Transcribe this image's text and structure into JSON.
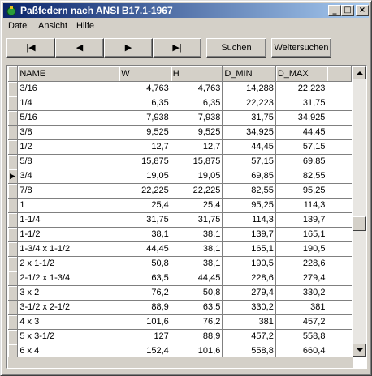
{
  "window": {
    "title": "Paßfedern nach ANSI B17.1-1967"
  },
  "titlebar_buttons": {
    "minimize": "_",
    "maximize": "□",
    "close": "×"
  },
  "menu": [
    {
      "label": "Datei"
    },
    {
      "label": "Ansicht"
    },
    {
      "label": "Hilfe"
    }
  ],
  "toolbar": {
    "first": "|◀",
    "prev": "◀",
    "next": "▶",
    "last": "▶|",
    "search": "Suchen",
    "search_next": "Weitersuchen"
  },
  "table": {
    "columns": [
      "NAME",
      "W",
      "H",
      "D_MIN",
      "D_MAX"
    ],
    "current_row_indicator": "▶",
    "current_row": 6,
    "rows": [
      [
        "3/16",
        "4,763",
        "4,763",
        "14,288",
        "22,223"
      ],
      [
        "1/4",
        "6,35",
        "6,35",
        "22,223",
        "31,75"
      ],
      [
        "5/16",
        "7,938",
        "7,938",
        "31,75",
        "34,925"
      ],
      [
        "3/8",
        "9,525",
        "9,525",
        "34,925",
        "44,45"
      ],
      [
        "1/2",
        "12,7",
        "12,7",
        "44,45",
        "57,15"
      ],
      [
        "5/8",
        "15,875",
        "15,875",
        "57,15",
        "69,85"
      ],
      [
        "3/4",
        "19,05",
        "19,05",
        "69,85",
        "82,55"
      ],
      [
        "7/8",
        "22,225",
        "22,225",
        "82,55",
        "95,25"
      ],
      [
        "1",
        "25,4",
        "25,4",
        "95,25",
        "114,3"
      ],
      [
        "1-1/4",
        "31,75",
        "31,75",
        "114,3",
        "139,7"
      ],
      [
        "1-1/2",
        "38,1",
        "38,1",
        "139,7",
        "165,1"
      ],
      [
        "1-3/4 x 1-1/2",
        "44,45",
        "38,1",
        "165,1",
        "190,5"
      ],
      [
        "2 x 1-1/2",
        "50,8",
        "38,1",
        "190,5",
        "228,6"
      ],
      [
        "2-1/2 x 1-3/4",
        "63,5",
        "44,45",
        "228,6",
        "279,4"
      ],
      [
        "3 x 2",
        "76,2",
        "50,8",
        "279,4",
        "330,2"
      ],
      [
        "3-1/2 x 2-1/2",
        "88,9",
        "63,5",
        "330,2",
        "381"
      ],
      [
        "4 x 3",
        "101,6",
        "76,2",
        "381",
        "457,2"
      ],
      [
        "5 x 3-1/2",
        "127",
        "88,9",
        "457,2",
        "558,8"
      ],
      [
        "6 x 4",
        "152,4",
        "101,6",
        "558,8",
        "660,4"
      ]
    ]
  },
  "scroll": {
    "vertical_position": 0.55
  },
  "colors": {
    "titlebar_start": "#0a246a",
    "titlebar_end": "#a6caf0",
    "face": "#d4d0c8"
  }
}
